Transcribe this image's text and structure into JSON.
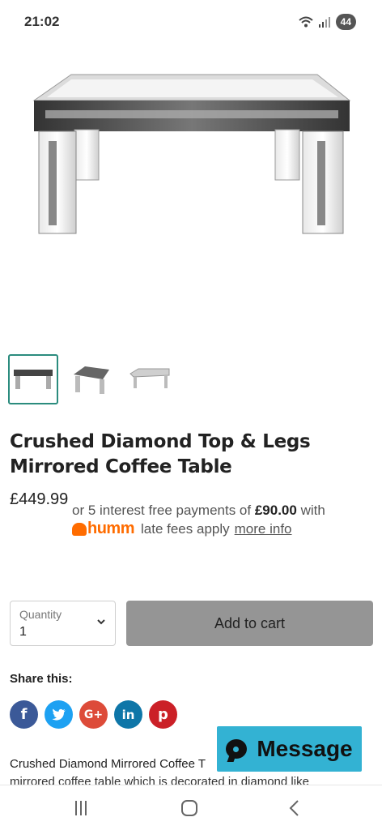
{
  "status": {
    "time": "21:02",
    "battery": "44"
  },
  "product": {
    "title": "Crushed Diamond Top & Legs Mirrored Coffee Table",
    "price": "£449.99"
  },
  "humm": {
    "text_pre": "or 5 interest free payments of ",
    "amount": "£90.00",
    "text_post": " with",
    "logo": "humm",
    "late_fees": "late fees apply",
    "more_info": "more info",
    "brand_color": "#ff6c00"
  },
  "quantity": {
    "label": "Quantity",
    "value": "1"
  },
  "cart": {
    "label": "Add to cart"
  },
  "share": {
    "label": "Share this:",
    "buttons": [
      {
        "name": "facebook",
        "glyph": "f"
      },
      {
        "name": "twitter",
        "glyph": "t"
      },
      {
        "name": "google-plus",
        "glyph": "G+"
      },
      {
        "name": "linkedin",
        "glyph": "in"
      },
      {
        "name": "pinterest",
        "glyph": "p"
      }
    ]
  },
  "message": {
    "label": "Message"
  },
  "description": {
    "line1": "Crushed Diamond Mirrored Coffee T",
    "line2": "mirrored coffee table which is decorated in diamond like"
  },
  "icons": {
    "wifi": "wifi-icon",
    "signal": "signal-icon",
    "expand": "chevron-down-icon",
    "chat": "chat-icon",
    "nav_recent": "recent-apps-icon",
    "nav_home": "home-icon",
    "nav_back": "back-icon"
  }
}
